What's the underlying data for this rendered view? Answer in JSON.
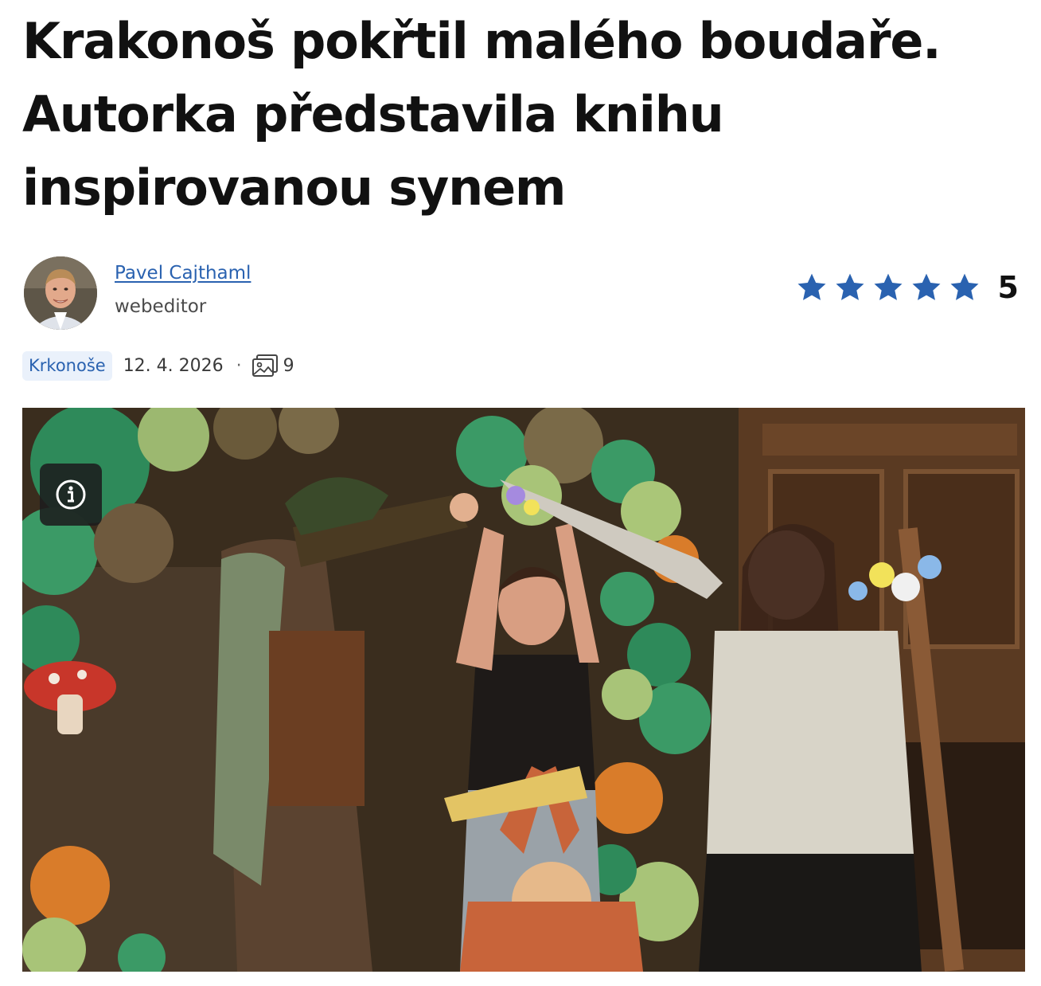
{
  "article": {
    "headline": "Krakonoš pokřtil malého boudaře. Autorka představila knihu inspirovanou synem"
  },
  "author": {
    "name": "Pavel Cajthaml",
    "role": "webeditor",
    "avatar_icon": "author-portrait"
  },
  "rating": {
    "stars": 5,
    "max_stars": 5,
    "value": "5",
    "star_color": "#2a62b0"
  },
  "meta": {
    "tag": "Krkonoše",
    "date": "12. 4. 2026",
    "separator": "·",
    "gallery_icon": "image-gallery-icon",
    "gallery_count": "9"
  },
  "photo": {
    "info_icon": "info-icon"
  },
  "colors": {
    "accent": "#2a62b0",
    "tag_background": "#eaf1fb",
    "text": "#111111"
  }
}
